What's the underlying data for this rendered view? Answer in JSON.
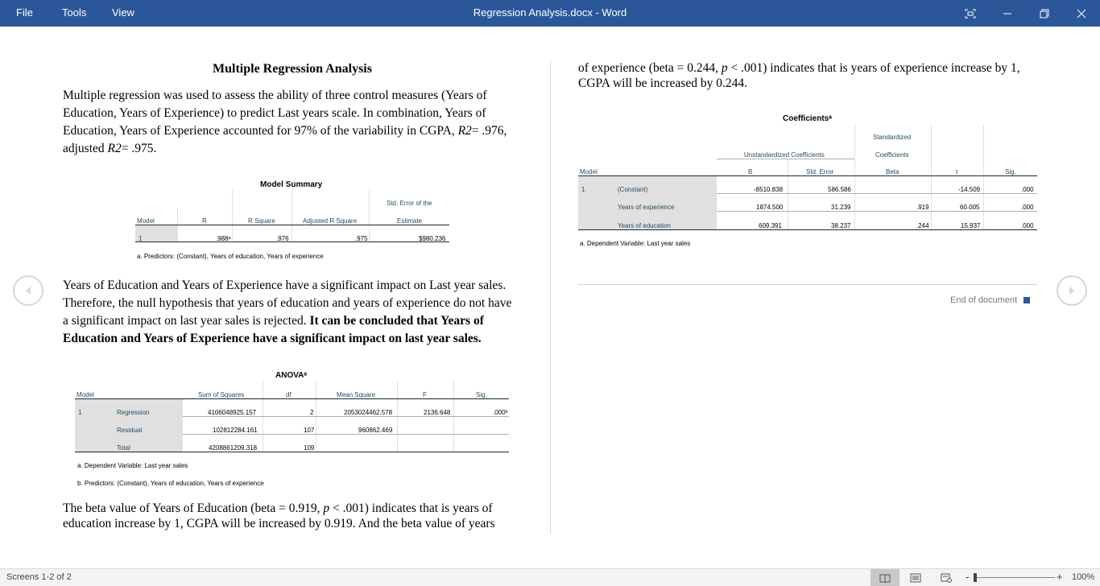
{
  "menu": {
    "file": "File",
    "tools": "Tools",
    "view": "View"
  },
  "window_title": "Regression Analysis.docx  -  Word",
  "page1": {
    "heading": "Multiple Regression Analysis",
    "para1_lines": [
      "Multiple regression was used to assess the ability of three control measures (Years of",
      "Education, Years of Experience) to predict Last years scale. In combination, Years of",
      "Education, Years of Experience accounted for 97% of the variability in CGPA, ",
      "adjusted "
    ],
    "para1_r2": "R2",
    "para1_r2_val": "= .976,",
    "para1_adj_r2": "R2",
    "para1_adj_val": "= .975.",
    "para2_lines": [
      "Years of Education and Years of Experience have a significant impact on Last year sales.",
      "Therefore, the null hypothesis that years of education and years of experience do not have",
      "a significant impact on last year sales is rejected. "
    ],
    "para2_bold_1": "It can be concluded that Years of",
    "para2_bold_2": "Education and Years of Experience have a significant impact on last year sales.",
    "para3_line1_a": "The beta value of Years of Education (beta = 0.919, ",
    "para3_p": "p",
    "para3_line1_b": " < .001) indicates that is years of",
    "para3_line2": "education increase by 1, CGPA will be increased by 0.919. And the beta value of years"
  },
  "page2": {
    "line1_a": "of experience (beta = 0.244, ",
    "line1_p": "p",
    "line1_b": " < .001) indicates that is years of experience increase by 1,",
    "line2": "CGPA will be increased by 0.244.",
    "end_of_document": "End of document"
  },
  "model_summary": {
    "title": "Model Summary",
    "headers": [
      "Model",
      "R",
      "R Square",
      "Adjusted R Square",
      "Std. Error of the",
      "Estimate"
    ],
    "row": [
      "1",
      ".988ᵃ",
      ".976",
      ".975",
      "$980.236"
    ],
    "footnote": "a. Predictors: (Constant), Years of education, Years of experience"
  },
  "anova": {
    "title": "ANOVAᵃ",
    "headers": [
      "Model",
      "Sum of Squares",
      "df",
      "Mean Square",
      "F",
      "Sig."
    ],
    "model": "1",
    "rows": [
      {
        "label": "Regression",
        "ss": "4106048925.157",
        "df": "2",
        "ms": "2053024462.578",
        "f": "2136.648",
        "sig": ".000ᵇ"
      },
      {
        "label": "Residual",
        "ss": "102812284.161",
        "df": "107",
        "ms": "960862.469",
        "f": "",
        "sig": ""
      },
      {
        "label": "Total",
        "ss": "4208861209.318",
        "df": "109",
        "ms": "",
        "f": "",
        "sig": ""
      }
    ],
    "footnote_a": "a. Dependent Variable: Last year sales",
    "footnote_b": "b. Predictors: (Constant), Years of education, Years of experience"
  },
  "coefficients": {
    "title": "Coefficientsᵃ",
    "header_std_1": "Standardized",
    "header_unstd": "Unstandardized Coefficients",
    "header_std_2": "Coefficients",
    "headers": [
      "Model",
      "B",
      "Std. Error",
      "Beta",
      "t",
      "Sig."
    ],
    "model": "1",
    "rows": [
      {
        "label": "(Constant)",
        "b": "-8510.838",
        "se": "586.586",
        "beta": "",
        "t": "-14.509",
        "sig": ".000"
      },
      {
        "label": "Years of experience",
        "b": "1874.500",
        "se": "31.239",
        "beta": ".919",
        "t": "60.005",
        "sig": ".000"
      },
      {
        "label": "Years of education",
        "b": "609.391",
        "se": "38.237",
        "beta": ".244",
        "t": "15.937",
        "sig": ".000"
      }
    ],
    "footnote": "a. Dependent Variable: Last year sales"
  },
  "status": {
    "screens": "Screens 1-2 of 2",
    "zoom": "100%",
    "minus": "-",
    "plus": "+"
  },
  "colors": {
    "titlebar": "#2b579a",
    "spss_label": "#264a60",
    "shade": "#e0e0e0"
  }
}
